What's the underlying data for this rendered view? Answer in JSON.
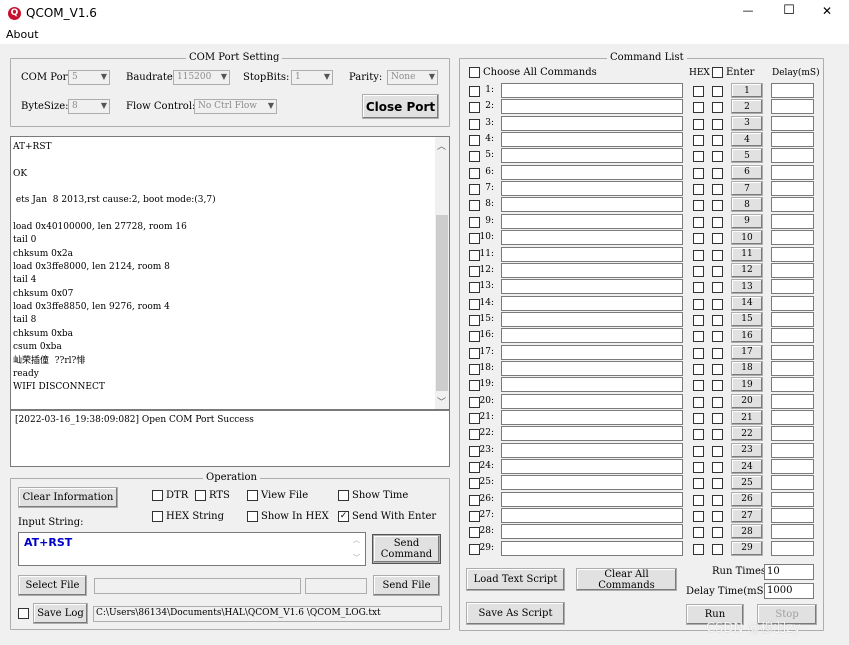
{
  "window": {
    "title": "QCOM_V1.6",
    "menu_about": "About",
    "minimize": "—",
    "maximize": "☐",
    "close": "✕"
  },
  "port_setting": {
    "group_title": "COM Port Setting",
    "com_label": "COM Port:",
    "com_value": "5",
    "baud_label": "Baudrate:",
    "baud_value": "115200",
    "stopbits_label": "StopBits:",
    "stopbits_value": "1",
    "parity_label": "Parity:",
    "parity_value": "None",
    "bytesize_label": "ByteSize:",
    "bytesize_value": "8",
    "flow_label": "Flow Control:",
    "flow_value": "No Ctrl Flow",
    "close_port": "Close Port"
  },
  "receive_log": [
    "AT+RST",
    "",
    "OK",
    "",
    " ets Jan  8 2013,rst cause:2, boot mode:(3,7)",
    "",
    "load 0x40100000, len 27728, room 16",
    "tail 0",
    "chksum 0x2a",
    "load 0x3ffe8000, len 2124, room 8",
    "tail 4",
    "chksum 0x07",
    "load 0x3ffe8850, len 9276, room 4",
    "tail 8",
    "chksum 0xba",
    "csum 0xba",
    "屾荣插僮  ??rl?悱",
    "ready",
    "WIFI DISCONNECT"
  ],
  "status_log": "[2022-03-16_19:38:09:082] Open COM Port Success",
  "operation": {
    "group_title": "Operation",
    "clear_info": "Clear Information",
    "dtr": "DTR",
    "rts": "RTS",
    "view_file": "View File",
    "show_time": "Show Time",
    "hex_string": "HEX String",
    "show_in_hex": "Show In HEX",
    "send_with_enter": "Send With Enter",
    "input_label": "Input String:",
    "input_value": "AT+RST",
    "send_command": "Send Command",
    "select_file": "Select File",
    "send_file": "Send File",
    "save_log": "Save Log",
    "log_path": "C:\\Users\\86134\\Documents\\HAL\\QCOM_V1.6 \\QCOM_LOG.txt",
    "send_with_enter_checked": "✓"
  },
  "command_list": {
    "group_title": "Command List",
    "choose_all": "Choose All Commands",
    "hex_header": "HEX",
    "enter_header": "Enter",
    "delay_header": "Delay(mS)",
    "rows": [
      {
        "label": "1:",
        "btn": "1"
      },
      {
        "label": "2:",
        "btn": "2"
      },
      {
        "label": "3:",
        "btn": "3"
      },
      {
        "label": "4:",
        "btn": "4"
      },
      {
        "label": "5:",
        "btn": "5"
      },
      {
        "label": "6:",
        "btn": "6"
      },
      {
        "label": "7:",
        "btn": "7"
      },
      {
        "label": "8:",
        "btn": "8"
      },
      {
        "label": "9:",
        "btn": "9"
      },
      {
        "label": "10:",
        "btn": "10"
      },
      {
        "label": "11:",
        "btn": "11"
      },
      {
        "label": "12:",
        "btn": "12"
      },
      {
        "label": "13:",
        "btn": "13"
      },
      {
        "label": "14:",
        "btn": "14"
      },
      {
        "label": "15:",
        "btn": "15"
      },
      {
        "label": "16:",
        "btn": "16"
      },
      {
        "label": "17:",
        "btn": "17"
      },
      {
        "label": "18:",
        "btn": "18"
      },
      {
        "label": "19:",
        "btn": "19"
      },
      {
        "label": "20:",
        "btn": "20"
      },
      {
        "label": "21:",
        "btn": "21"
      },
      {
        "label": "22:",
        "btn": "22"
      },
      {
        "label": "23:",
        "btn": "23"
      },
      {
        "label": "24:",
        "btn": "24"
      },
      {
        "label": "25:",
        "btn": "25"
      },
      {
        "label": "26:",
        "btn": "26"
      },
      {
        "label": "27:",
        "btn": "27"
      },
      {
        "label": "28:",
        "btn": "28"
      },
      {
        "label": "29:",
        "btn": "29"
      }
    ],
    "load_script": "Load Text Script",
    "clear_all": "Clear All Commands",
    "save_script": "Save As Script",
    "run_times_label": "Run Times:",
    "run_times_value": "10",
    "delay_time_label": "Delay Time(mS):",
    "delay_time_value": "1000",
    "run": "Run",
    "stop": "Stop"
  },
  "watermark": "CSDN @穆羽zy"
}
